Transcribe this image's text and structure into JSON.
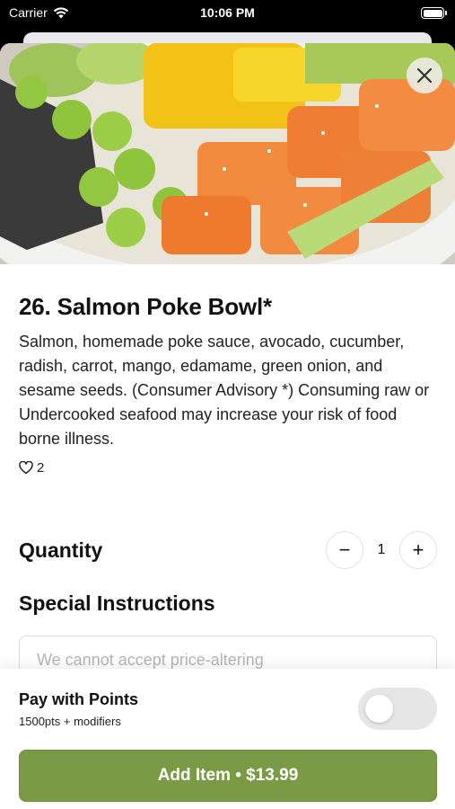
{
  "status_bar": {
    "carrier": "Carrier",
    "time": "10:06 PM"
  },
  "item": {
    "title": "26. Salmon Poke Bowl*",
    "description": "Salmon, homemade poke sauce, avocado, cucumber, radish, carrot, mango, edamame, green onion, and sesame seeds. (Consumer Advisory *) Consuming raw or Undercooked seafood may increase your risk of food borne illness.",
    "likes": "2"
  },
  "quantity": {
    "label": "Quantity",
    "value": "1",
    "decrement_symbol": "−",
    "increment_symbol": "+"
  },
  "special_instructions": {
    "label": "Special Instructions",
    "placeholder": "We cannot accept price-altering"
  },
  "points": {
    "title": "Pay with Points",
    "subtitle": "1500pts + modifiers",
    "enabled": false
  },
  "add_button": {
    "label": "Add Item • $13.99"
  },
  "colors": {
    "accent": "#7a9a46",
    "toggle_off": "#e6e6e6"
  },
  "icons": {
    "close": "close-icon",
    "like": "heart-outline-icon",
    "wifi": "wifi-icon",
    "battery": "battery-icon"
  }
}
